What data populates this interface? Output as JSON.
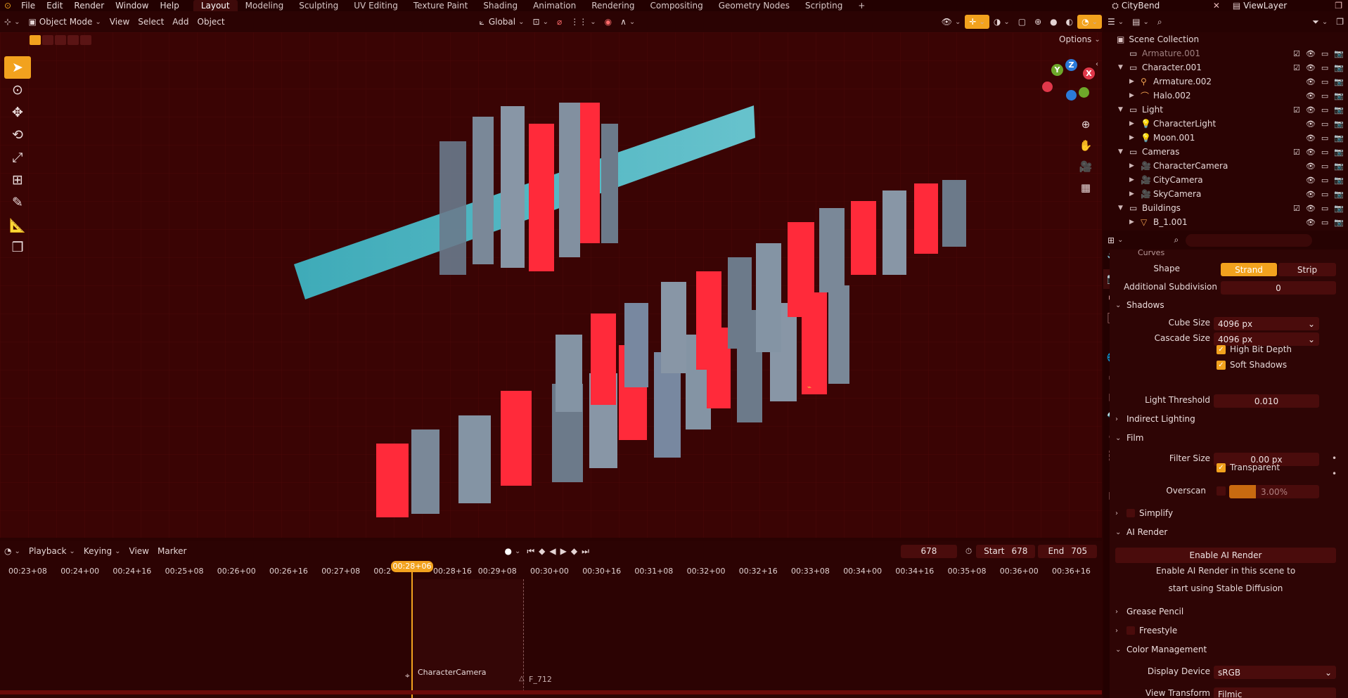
{
  "topbar": {
    "menus": [
      "File",
      "Edit",
      "Render",
      "Window",
      "Help"
    ],
    "workspaces": [
      "Layout",
      "Modeling",
      "Sculpting",
      "UV Editing",
      "Texture Paint",
      "Shading",
      "Animation",
      "Rendering",
      "Compositing",
      "Geometry Nodes",
      "Scripting"
    ],
    "add_tab": "+",
    "scene": "CityBend",
    "view_layer": "ViewLayer"
  },
  "viewport_header": {
    "mode": "Object Mode",
    "menus": [
      "View",
      "Select",
      "Add",
      "Object"
    ],
    "transform_orientation": "Global",
    "options": "Options"
  },
  "gizmo": {
    "x": "X",
    "y": "Y",
    "z": "Z"
  },
  "outliner": {
    "title": "Scene Collection",
    "rows": [
      {
        "name": "Armature.001",
        "depth": 0,
        "kind": "collection",
        "dim": true
      },
      {
        "name": "Character.001",
        "depth": 0,
        "kind": "collection"
      },
      {
        "name": "Armature.002",
        "depth": 1,
        "kind": "armature"
      },
      {
        "name": "Halo.002",
        "depth": 1,
        "kind": "curve"
      },
      {
        "name": "Light",
        "depth": 0,
        "kind": "collection"
      },
      {
        "name": "CharacterLight",
        "depth": 1,
        "kind": "light"
      },
      {
        "name": "Moon.001",
        "depth": 1,
        "kind": "light"
      },
      {
        "name": "Cameras",
        "depth": 0,
        "kind": "collection"
      },
      {
        "name": "CharacterCamera",
        "depth": 1,
        "kind": "camera"
      },
      {
        "name": "CityCamera",
        "depth": 1,
        "kind": "camera"
      },
      {
        "name": "SkyCamera",
        "depth": 1,
        "kind": "camera"
      },
      {
        "name": "Buildings",
        "depth": 0,
        "kind": "collection"
      },
      {
        "name": "B_1.001",
        "depth": 1,
        "kind": "mesh"
      }
    ]
  },
  "properties": {
    "curves_header": "Curves",
    "shape_label": "Shape",
    "shape_strand": "Strand",
    "shape_strip": "Strip",
    "subdiv_label": "Additional Subdivision",
    "subdiv_value": "0",
    "shadows": "Shadows",
    "cube_size_label": "Cube Size",
    "cube_size": "4096 px",
    "cascade_size_label": "Cascade Size",
    "cascade_size": "4096 px",
    "high_bit_depth": "High Bit Depth",
    "soft_shadows": "Soft Shadows",
    "light_threshold_label": "Light Threshold",
    "light_threshold": "0.010",
    "indirect_lighting": "Indirect Lighting",
    "film": "Film",
    "filter_size_label": "Filter Size",
    "filter_size": "0.00 px",
    "transparent": "Transparent",
    "overscan_label": "Overscan",
    "overscan": "3.00%",
    "simplify": "Simplify",
    "ai_render": "AI Render",
    "enable_ai_render": "Enable AI Render",
    "ai_note_1": "Enable AI Render in this scene to",
    "ai_note_2": "start using Stable Diffusion",
    "grease_pencil": "Grease Pencil",
    "freestyle": "Freestyle",
    "color_management": "Color Management",
    "display_device_label": "Display Device",
    "display_device": "sRGB",
    "view_transform_label": "View Transform",
    "view_transform": "Filmic"
  },
  "timeline": {
    "menus": [
      "Playback",
      "Keying",
      "View",
      "Marker"
    ],
    "current_frame": "678",
    "start_label": "Start",
    "start": "678",
    "end_label": "End",
    "end": "705",
    "playhead": "00:28+06",
    "ticks": [
      "00:23+08",
      "00:24+00",
      "00:24+16",
      "00:25+08",
      "00:26+00",
      "00:26+16",
      "00:27+08",
      "00:2",
      "00:28+16",
      "00:29+08",
      "00:30+00",
      "00:30+16",
      "00:31+08",
      "00:32+00",
      "00:32+16",
      "00:33+08",
      "00:34+00",
      "00:34+16",
      "00:35+08",
      "00:36+00",
      "00:36+16"
    ],
    "camera_marker": "CharacterCamera",
    "frame_marker": "F_712"
  },
  "colors": {
    "accent": "#f2a21e",
    "background": "#2a0202",
    "neon_red": "#ff2a3a",
    "neon_cyan": "#4fd7e8"
  }
}
